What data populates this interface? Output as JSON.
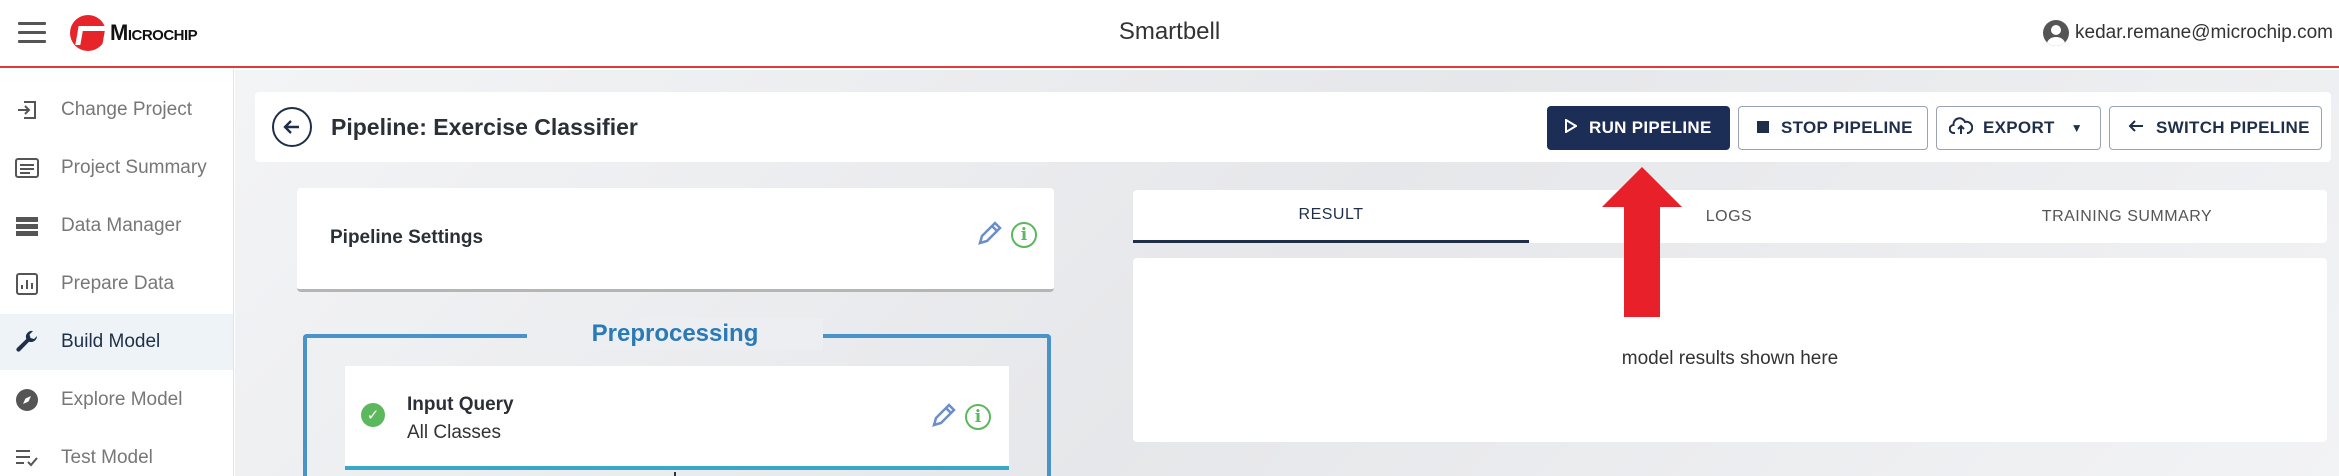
{
  "app": {
    "brand": "Microchip",
    "title": "Smartbell"
  },
  "user": {
    "email": "kedar.remane@microchip.com"
  },
  "sidebar": {
    "items": [
      {
        "label": "Change Project",
        "icon": "login-arrow-icon"
      },
      {
        "label": "Project Summary",
        "icon": "summary-icon"
      },
      {
        "label": "Data Manager",
        "icon": "storage-icon"
      },
      {
        "label": "Prepare Data",
        "icon": "chart-icon"
      },
      {
        "label": "Build Model",
        "icon": "wrench-icon",
        "active": true
      },
      {
        "label": "Explore Model",
        "icon": "compass-icon"
      },
      {
        "label": "Test Model",
        "icon": "checklist-icon"
      }
    ]
  },
  "header": {
    "title": "Pipeline: Exercise Classifier",
    "buttons": {
      "run": "RUN PIPELINE",
      "stop": "STOP PIPELINE",
      "export": "EXPORT",
      "switch": "SWITCH PIPELINE"
    }
  },
  "settings": {
    "title": "Pipeline Settings"
  },
  "preprocessing": {
    "label": "Preprocessing",
    "query": {
      "title": "Input Query",
      "subtitle": "All Classes",
      "status": "complete"
    }
  },
  "results": {
    "tabs": [
      "RESULT",
      "LOGS",
      "TRAINING SUMMARY"
    ],
    "active_tab": "RESULT",
    "placeholder": "model results shown here"
  },
  "colors": {
    "accent": "#1c2e55",
    "brand_red": "#e6242a",
    "annotation_arrow": "#e8202a",
    "preprocessing_blue": "#4a93c9",
    "success_green": "#5cb85c"
  }
}
